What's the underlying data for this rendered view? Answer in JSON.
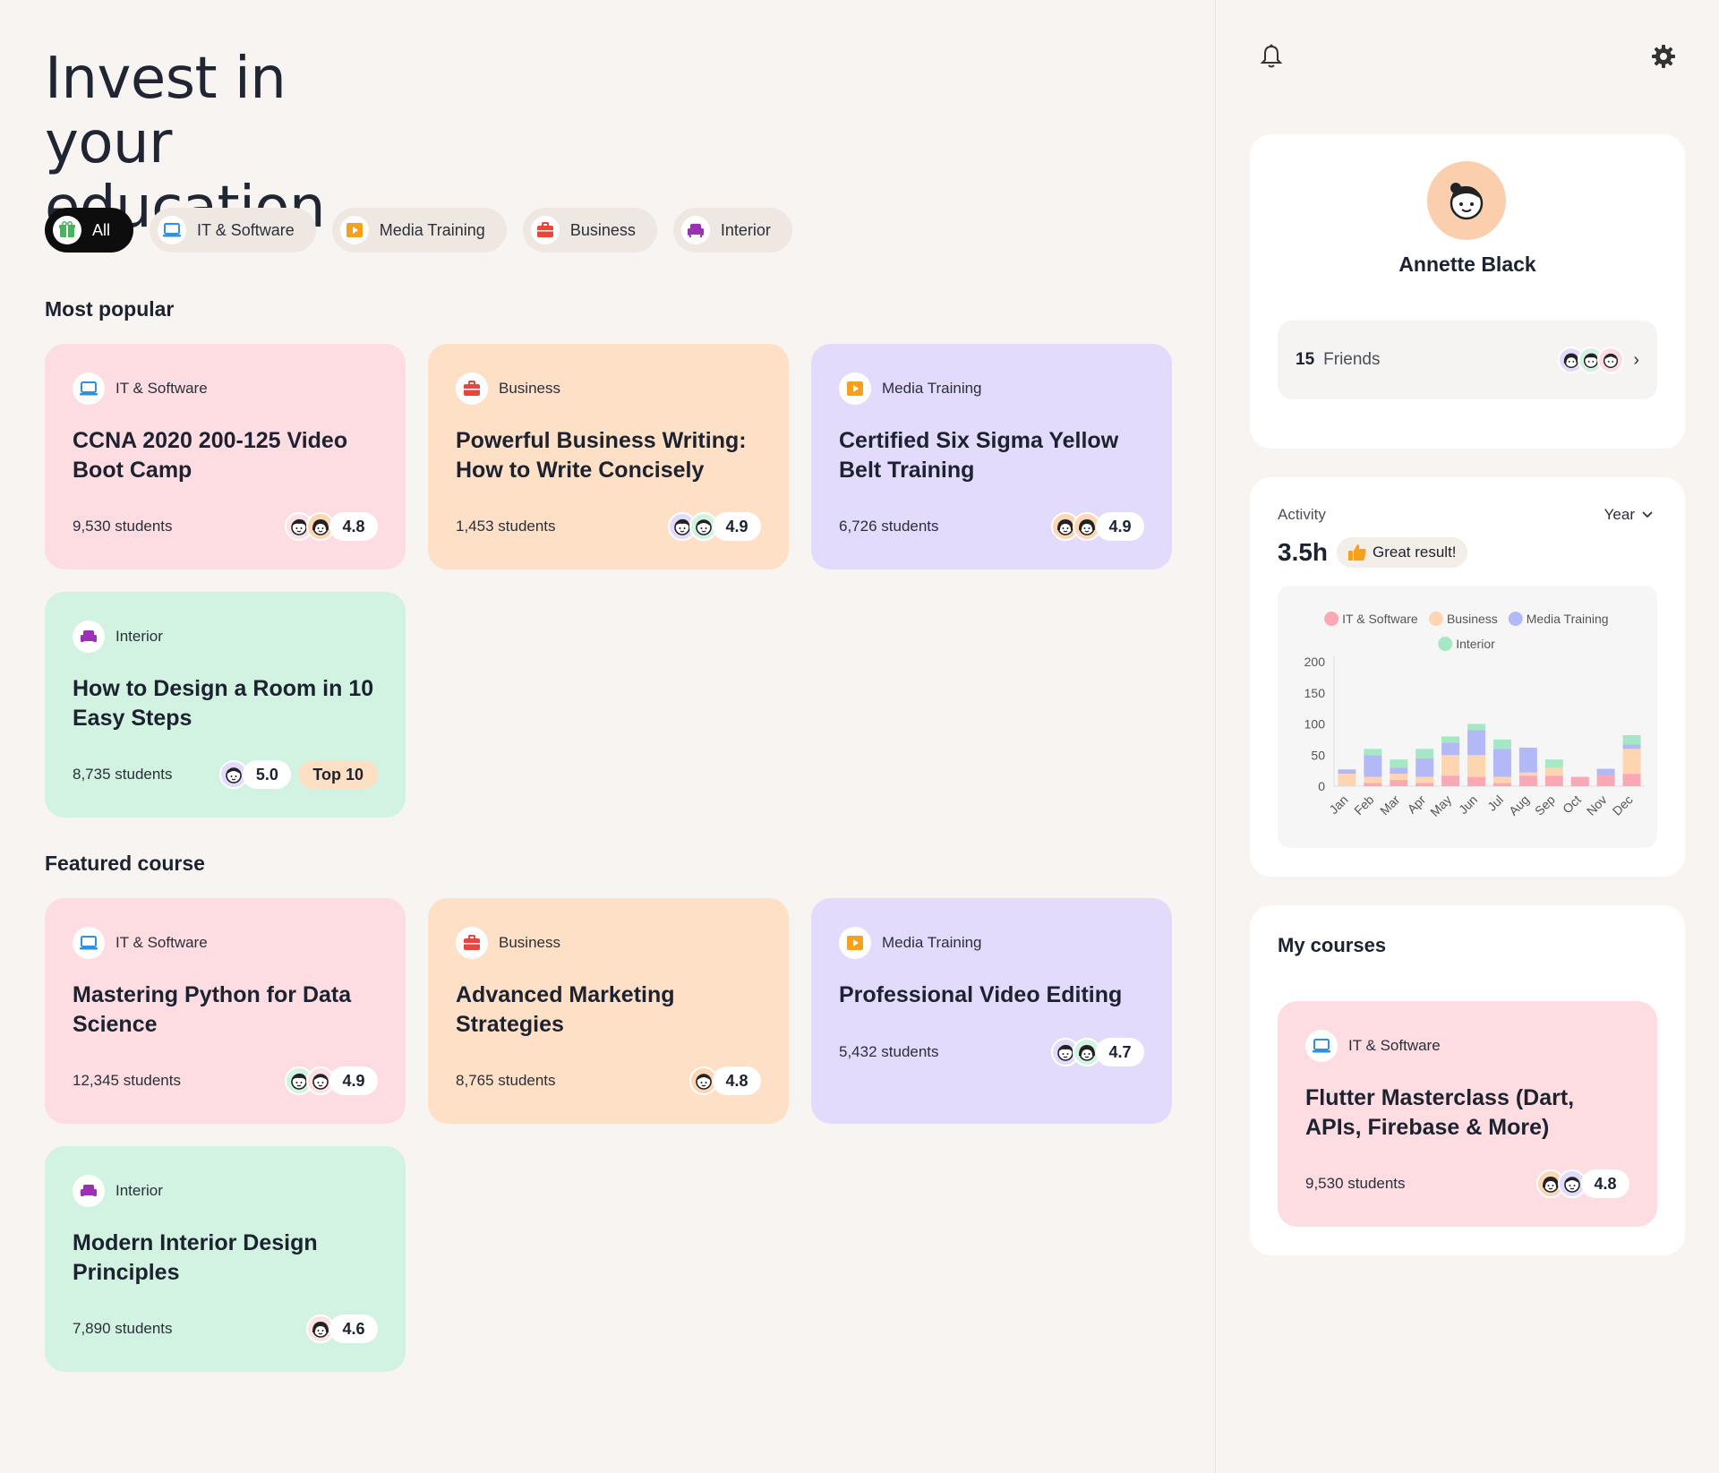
{
  "page": {
    "title": "Invest in your education"
  },
  "filters": [
    {
      "label": "All",
      "icon": "gift-icon",
      "active": true
    },
    {
      "label": "IT & Software",
      "icon": "laptop-icon"
    },
    {
      "label": "Media Training",
      "icon": "play-icon"
    },
    {
      "label": "Business",
      "icon": "briefcase-icon"
    },
    {
      "label": "Interior",
      "icon": "armchair-icon"
    }
  ],
  "sections": {
    "popular": "Most popular",
    "featured": "Featured course"
  },
  "popular": [
    {
      "category": "IT & Software",
      "title": "CCNA 2020 200-125 Video Boot Camp",
      "students": "9,530 students",
      "rating": "4.8"
    },
    {
      "category": "Business",
      "title": "Powerful Business Writing: How to Write Concisely",
      "students": "1,453 students",
      "rating": "4.9"
    },
    {
      "category": "Media Training",
      "title": "Certified Six Sigma Yellow Belt Training",
      "students": "6,726 students",
      "rating": "4.9"
    },
    {
      "category": "Interior",
      "title": "How to Design a Room in 10 Easy Steps",
      "students": "8,735 students",
      "rating": "5.0",
      "badge": "Top 10"
    }
  ],
  "featured": [
    {
      "category": "IT & Software",
      "title": "Mastering Python for Data Science",
      "students": "12,345 students",
      "rating": "4.9"
    },
    {
      "category": "Business",
      "title": "Advanced Marketing Strategies",
      "students": "8,765 students",
      "rating": "4.8"
    },
    {
      "category": "Media Training",
      "title": "Professional Video Editing",
      "students": "5,432 students",
      "rating": "4.7"
    },
    {
      "category": "Interior",
      "title": "Modern Interior Design Principles",
      "students": "7,890 students",
      "rating": "4.6"
    }
  ],
  "profile": {
    "name": "Annette Black",
    "friends_count": "15",
    "friends_label": "Friends"
  },
  "activity": {
    "label": "Activity",
    "period": "Year",
    "hours": "3.5h",
    "badge": "Great result!"
  },
  "colors": {
    "it": "#f9a8b4",
    "business": "#fdd5b0",
    "media": "#b3b9f7",
    "interior": "#a6e8c6"
  },
  "chart_data": {
    "type": "bar",
    "stacked": true,
    "categories": [
      "Jan",
      "Feb",
      "Mar",
      "Apr",
      "May",
      "Jun",
      "Jul",
      "Aug",
      "Sep",
      "Oct",
      "Nov",
      "Dec"
    ],
    "series": [
      {
        "name": "IT & Software",
        "values": [
          0,
          5,
          10,
          5,
          17,
          15,
          5,
          17,
          17,
          15,
          18,
          20
        ]
      },
      {
        "name": "Business",
        "values": [
          20,
          10,
          10,
          10,
          33,
          35,
          10,
          5,
          13,
          0,
          0,
          40
        ]
      },
      {
        "name": "Media Training",
        "values": [
          7,
          35,
          10,
          30,
          20,
          40,
          45,
          40,
          0,
          0,
          10,
          7
        ]
      },
      {
        "name": "Interior",
        "values": [
          0,
          10,
          13,
          15,
          10,
          10,
          15,
          0,
          13,
          0,
          0,
          15
        ]
      }
    ],
    "ylim": [
      0,
      200
    ],
    "yticks": [
      0,
      50,
      100,
      150,
      200
    ],
    "legend": "top"
  },
  "mycourses": {
    "title": "My courses",
    "course": {
      "category": "IT & Software",
      "title": "Flutter Masterclass (Dart, APIs, Firebase & More)",
      "students": "9,530 students",
      "rating": "4.8"
    }
  }
}
